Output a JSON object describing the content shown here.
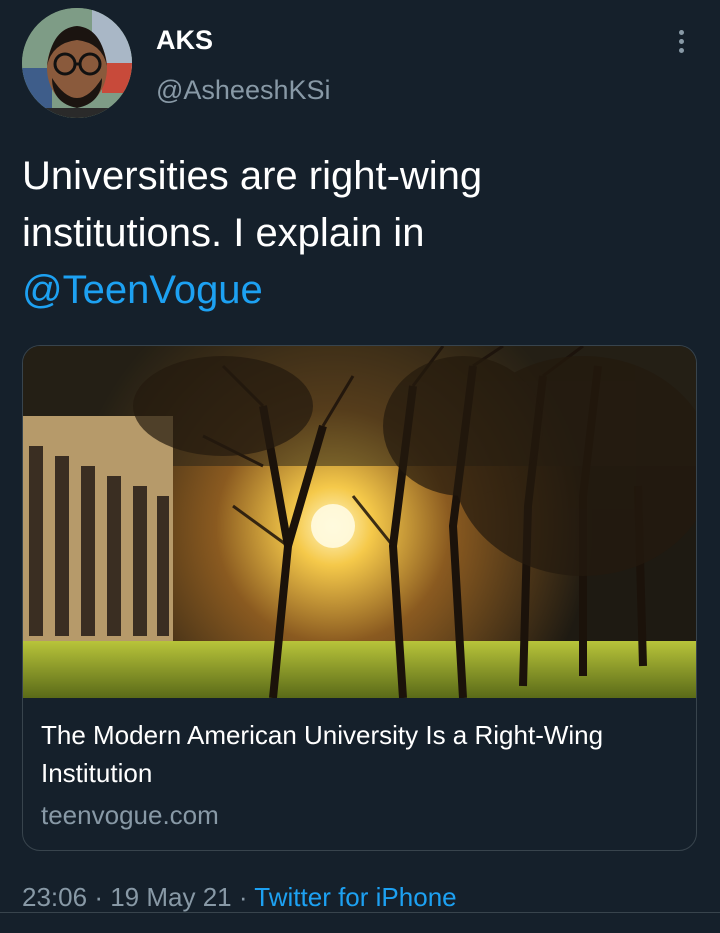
{
  "author": {
    "display_name": "AKS",
    "handle": "@AsheeshKSi",
    "avatar_icon": "profile-photo"
  },
  "tweet": {
    "text_line1": "Universities are right-wing",
    "text_line2": "institutions. I explain in",
    "mention": "@TeenVogue"
  },
  "card": {
    "title": "The Modern American University Is a Right-Wing Institution",
    "domain": "teenvogue.com",
    "image_icon": "campus-trees-sunset-image"
  },
  "meta": {
    "time": "23:06",
    "date": "19 May 21",
    "separator": "·",
    "source": "Twitter for iPhone"
  },
  "colors": {
    "background": "#15202b",
    "link": "#1da1f2",
    "secondary_text": "#8899a6",
    "border": "#38444d"
  },
  "more_icon": "more-vertical-icon"
}
